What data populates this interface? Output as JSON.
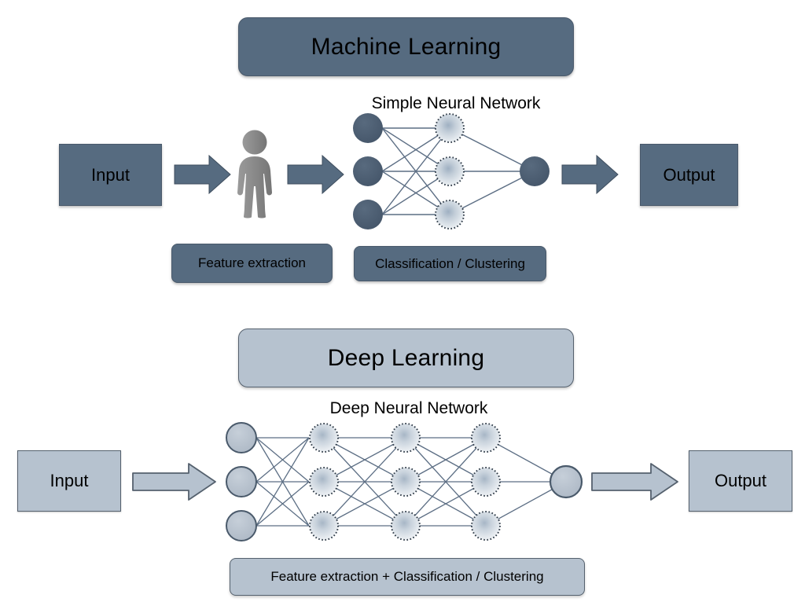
{
  "diagram": {
    "background": "#ffffff",
    "palette": {
      "dark_fill": "#566b80",
      "dark_stroke": "#49596b",
      "light_fill": "#b6c2cf",
      "light_stroke": "#55616e",
      "node_dark": "#4a5a6e",
      "node_light": "#c3ccd6",
      "edge": "#5c6e84",
      "person": "#8a8a8a"
    }
  },
  "machine_learning": {
    "title": "Machine Learning",
    "input_label": "Input",
    "output_label": "Output",
    "network_label": "Simple Neural Network",
    "feature_caption": "Feature extraction",
    "classification_caption": "Classification / Clustering",
    "person_icon": "person-icon",
    "arrows": [
      "arrow-input-to-person",
      "arrow-person-to-network",
      "arrow-network-to-output"
    ],
    "network": {
      "type": "neural-network",
      "layers": [
        {
          "name": "input",
          "count": 3,
          "style": "solid-dark"
        },
        {
          "name": "hidden",
          "count": 3,
          "style": "dotted-light"
        },
        {
          "name": "output",
          "count": 1,
          "style": "solid-dark"
        }
      ],
      "hidden_layer_count": 1,
      "total_nodes": 7
    }
  },
  "deep_learning": {
    "title": "Deep Learning",
    "input_label": "Input",
    "output_label": "Output",
    "network_label": "Deep Neural Network",
    "caption": "Feature extraction + Classification / Clustering",
    "arrows": [
      "arrow-input-to-network",
      "arrow-network-to-output"
    ],
    "network": {
      "type": "neural-network",
      "layers": [
        {
          "name": "input",
          "count": 3,
          "style": "solid-light"
        },
        {
          "name": "hidden-1",
          "count": 3,
          "style": "dotted-light"
        },
        {
          "name": "hidden-2",
          "count": 3,
          "style": "dotted-light"
        },
        {
          "name": "hidden-3",
          "count": 3,
          "style": "dotted-light"
        },
        {
          "name": "output",
          "count": 1,
          "style": "solid-light"
        }
      ],
      "hidden_layer_count": 3,
      "total_nodes": 13
    }
  }
}
